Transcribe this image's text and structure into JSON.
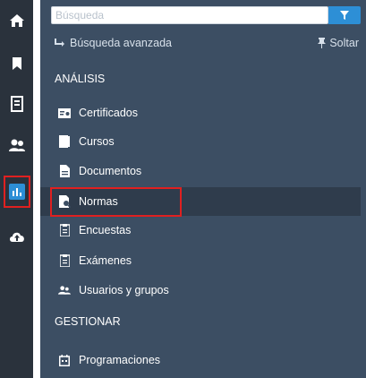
{
  "search": {
    "placeholder": "Búsqueda"
  },
  "links": {
    "advanced": "Búsqueda avanzada",
    "pin": "Soltar"
  },
  "sections": {
    "analysis": "ANÁLISIS",
    "manage": "GESTIONAR"
  },
  "menu": {
    "certificates": "Certificados",
    "courses": "Cursos",
    "documents": "Documentos",
    "standards": "Normas",
    "surveys": "Encuestas",
    "exams": "Exámenes",
    "users_groups": "Usuarios y grupos",
    "schedules": "Programaciones"
  },
  "colors": {
    "panel": "#3c4e63",
    "rail": "#2a323c",
    "accent": "#2d8fd6",
    "highlight": "#e02020"
  }
}
